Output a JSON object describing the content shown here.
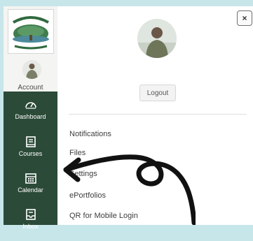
{
  "sidebar": {
    "logo_text": "Murrieta Valley Unified School District",
    "account_label": "Account",
    "nav": [
      {
        "label": "Dashboard",
        "icon": "dashboard-icon"
      },
      {
        "label": "Courses",
        "icon": "courses-icon"
      },
      {
        "label": "Calendar",
        "icon": "calendar-icon"
      },
      {
        "label": "Inbox",
        "icon": "inbox-icon"
      }
    ]
  },
  "tray": {
    "close_label": "×",
    "logout_label": "Logout",
    "links": [
      "Notifications",
      "Files",
      "Settings",
      "ePortfolios",
      "QR for Mobile Login"
    ]
  },
  "colors": {
    "background": "#c7e6ea",
    "nav_dark": "#2b4a38",
    "annotation_arrow": "#111111"
  }
}
